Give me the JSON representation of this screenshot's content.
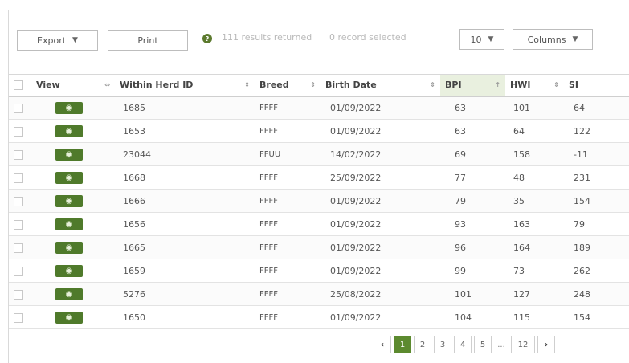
{
  "toolbar": {
    "export_label": "Export",
    "print_label": "Print",
    "results_text": "111 results returned",
    "selected_text": "0 record selected",
    "page_size": "10",
    "columns_label": "Columns"
  },
  "table": {
    "headers": {
      "view": "View",
      "herd_id": "Within Herd ID",
      "breed": "Breed",
      "birth_date": "Birth Date",
      "bpi": "BPI",
      "hwi": "HWI",
      "si": "SI"
    },
    "rows": [
      {
        "herd_id": "1685",
        "breed": "FFFF",
        "birth_date": "01/09/2022",
        "bpi": "63",
        "hwi": "101",
        "si": "64"
      },
      {
        "herd_id": "1653",
        "breed": "FFFF",
        "birth_date": "01/09/2022",
        "bpi": "63",
        "hwi": "64",
        "si": "122"
      },
      {
        "herd_id": "23044",
        "breed": "FFUU",
        "birth_date": "14/02/2022",
        "bpi": "69",
        "hwi": "158",
        "si": "-11"
      },
      {
        "herd_id": "1668",
        "breed": "FFFF",
        "birth_date": "25/09/2022",
        "bpi": "77",
        "hwi": "48",
        "si": "231"
      },
      {
        "herd_id": "1666",
        "breed": "FFFF",
        "birth_date": "01/09/2022",
        "bpi": "79",
        "hwi": "35",
        "si": "154"
      },
      {
        "herd_id": "1656",
        "breed": "FFFF",
        "birth_date": "01/09/2022",
        "bpi": "93",
        "hwi": "163",
        "si": "79"
      },
      {
        "herd_id": "1665",
        "breed": "FFFF",
        "birth_date": "01/09/2022",
        "bpi": "96",
        "hwi": "164",
        "si": "189"
      },
      {
        "herd_id": "1659",
        "breed": "FFFF",
        "birth_date": "01/09/2022",
        "bpi": "99",
        "hwi": "73",
        "si": "262"
      },
      {
        "herd_id": "5276",
        "breed": "FFFF",
        "birth_date": "25/08/2022",
        "bpi": "101",
        "hwi": "127",
        "si": "248"
      },
      {
        "herd_id": "1650",
        "breed": "FFFF",
        "birth_date": "01/09/2022",
        "bpi": "104",
        "hwi": "115",
        "si": "154"
      }
    ]
  },
  "pagination": {
    "pages": [
      "1",
      "2",
      "3",
      "4",
      "5"
    ],
    "ellipsis": "...",
    "last_page": "12",
    "active_page": "1"
  },
  "colors": {
    "accent": "#5c8a2f",
    "view_button": "#4f7a2b",
    "sorted_header": "#e9f0df"
  },
  "icons": {
    "view": "eye-icon",
    "info": "info-icon",
    "dropdown": "chevron-down-icon",
    "prev": "chevron-left-icon",
    "next": "chevron-right-icon"
  }
}
